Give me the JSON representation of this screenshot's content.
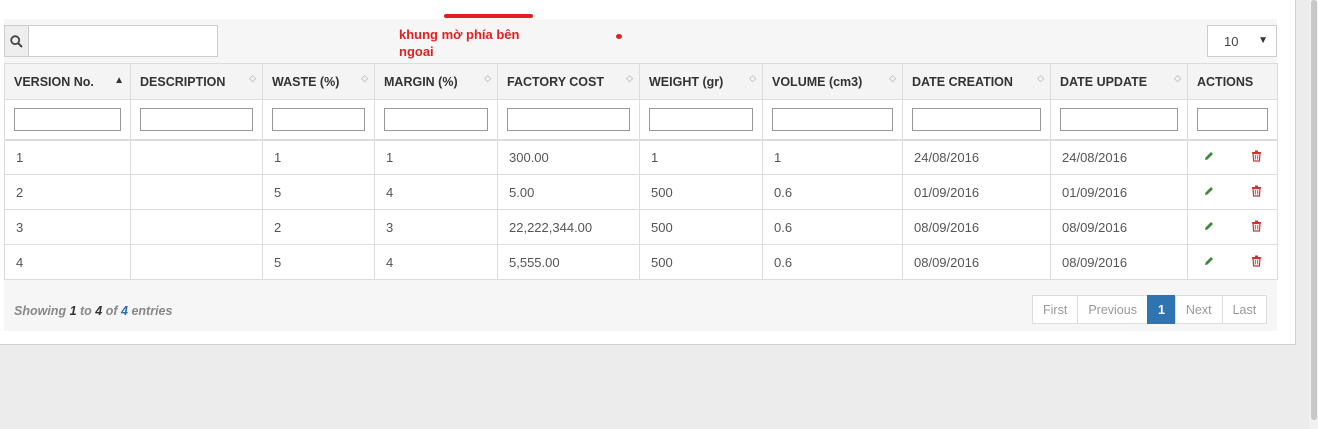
{
  "search": {
    "placeholder": "",
    "value": ""
  },
  "annotation": {
    "text": "khung mờ phía bên ngoai"
  },
  "page_length": {
    "selected": "10"
  },
  "columns": [
    "VERSION No.",
    "DESCRIPTION",
    "WASTE (%)",
    "MARGIN (%)",
    "FACTORY COST",
    "WEIGHT (gr)",
    "VOLUME (cm3)",
    "DATE CREATION",
    "DATE UPDATE",
    "ACTIONS"
  ],
  "rows": [
    [
      "1",
      "",
      "1",
      "1",
      "300.00",
      "1",
      "1",
      "24/08/2016",
      "24/08/2016"
    ],
    [
      "2",
      "",
      "5",
      "4",
      "5.00",
      "500",
      "0.6",
      "01/09/2016",
      "01/09/2016"
    ],
    [
      "3",
      "",
      "2",
      "3",
      "22,222,344.00",
      "500",
      "0.6",
      "08/09/2016",
      "08/09/2016"
    ],
    [
      "4",
      "",
      "5",
      "4",
      "5,555.00",
      "500",
      "0.6",
      "08/09/2016",
      "08/09/2016"
    ]
  ],
  "info": {
    "prefix": "Showing",
    "from": "1",
    "to_word": "to",
    "to": "4",
    "of_word": "of",
    "total": "4",
    "suffix": "entries"
  },
  "pagination": {
    "first": "First",
    "previous": "Previous",
    "current": "1",
    "next": "Next",
    "last": "Last"
  },
  "icons": {
    "search": "search-icon",
    "edit": "pencil-icon",
    "delete": "trash-icon",
    "sort": "sort-icon"
  },
  "colors": {
    "accent": "#2f73b0",
    "annotation": "#e02020",
    "edit": "#3f8a3a",
    "delete": "#cc3333"
  }
}
